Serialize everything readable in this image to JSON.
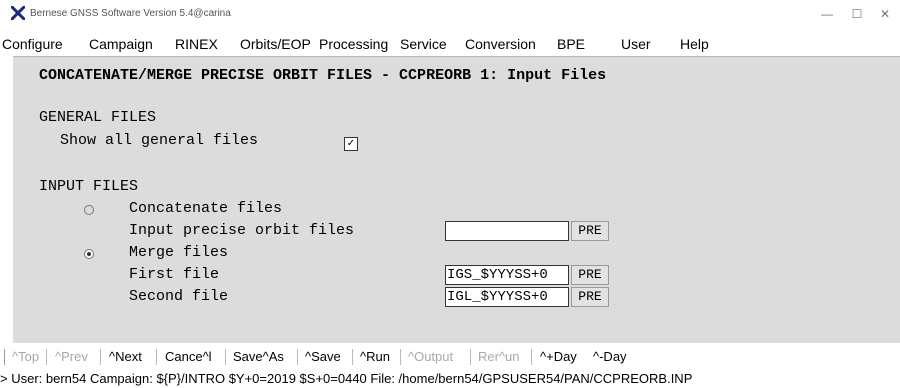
{
  "window": {
    "title": "Bernese GNSS Software Version 5.4@carina",
    "minimize": "—",
    "maximize": "☐",
    "close": "✕"
  },
  "menu": [
    "Configure",
    "Campaign",
    "RINEX",
    "Orbits/EOP",
    "Processing",
    "Service",
    "Conversion",
    "BPE",
    "User",
    "Help"
  ],
  "panel": {
    "title": "CONCATENATE/MERGE PRECISE ORBIT FILES - CCPREORB 1: Input Files",
    "general_heading": "GENERAL FILES",
    "show_all_label": "Show all general files",
    "show_all_checked": "✓",
    "input_heading": "INPUT FILES",
    "concatenate_label": "Concatenate files",
    "input_precise_label": "Input precise orbit files",
    "input_precise_value": "",
    "merge_label": "Merge files",
    "first_label": "First  file",
    "first_value": "IGS_$YYYSS+0",
    "second_label": "Second file",
    "second_value": "IGL_$YYYSS+0",
    "pre_label": "PRE"
  },
  "toolbar": {
    "top": "^Top",
    "prev": "^Prev",
    "next": "^Next",
    "cancel": "Cance^l",
    "save_as": "Save^As",
    "save": "^Save",
    "run": "^Run",
    "output": "^Output",
    "rerun": "Rer^un",
    "plus_day": "^+Day",
    "minus_day": "^-Day"
  },
  "status": "> User: bern54  Campaign: ${P}/INTRO  $Y+0=2019  $S+0=0440  File: /home/bern54/GPSUSER54/PAN/CCPREORB.INP"
}
